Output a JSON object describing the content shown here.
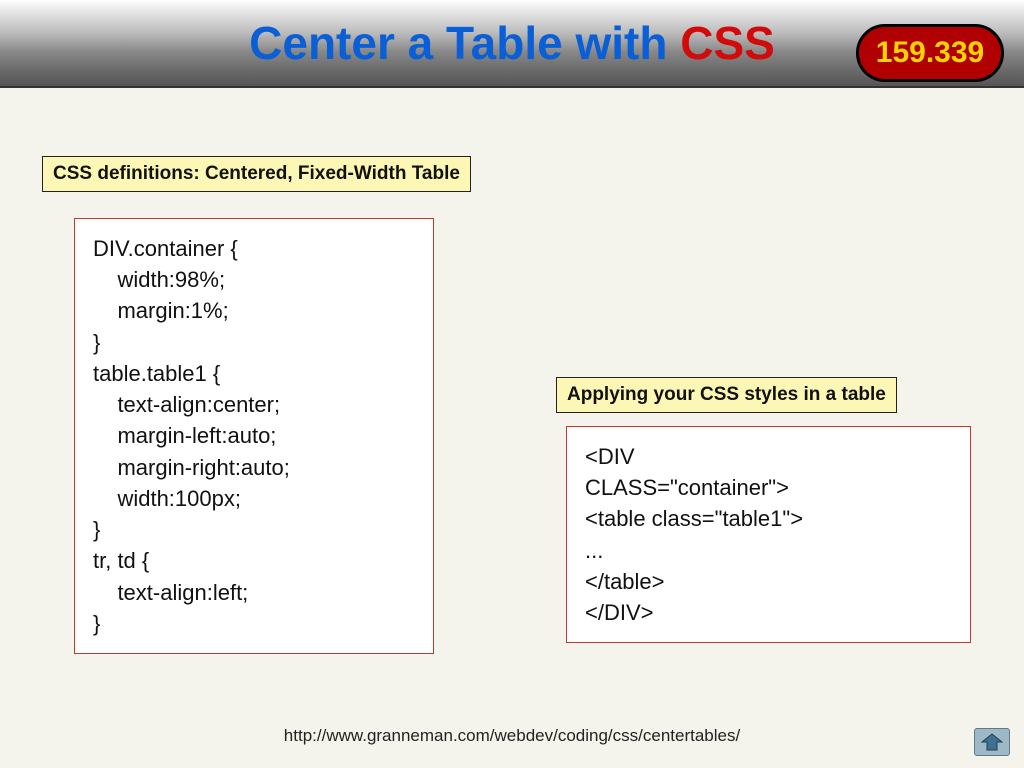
{
  "header": {
    "title_plain": "Center a Table with ",
    "title_accent": "CSS",
    "badge": "159.339"
  },
  "labels": {
    "css_defs": "CSS definitions:  Centered, Fixed-Width Table",
    "apply_css": "Applying your CSS styles in a table"
  },
  "code": {
    "css_block": "DIV.container {\n    width:98%;\n    margin:1%;\n}\ntable.table1 {\n    text-align:center;\n    margin-left:auto;\n    margin-right:auto;\n    width:100px;\n}\ntr, td {\n    text-align:left;\n}",
    "html_block": "<DIV\nCLASS=\"container\">\n<table class=\"table1\">\n...\n</table>\n</DIV>"
  },
  "footer": {
    "url": "http://www.granneman.com/webdev/coding/css/centertables/"
  },
  "icons": {
    "nav": "home-up-icon"
  }
}
